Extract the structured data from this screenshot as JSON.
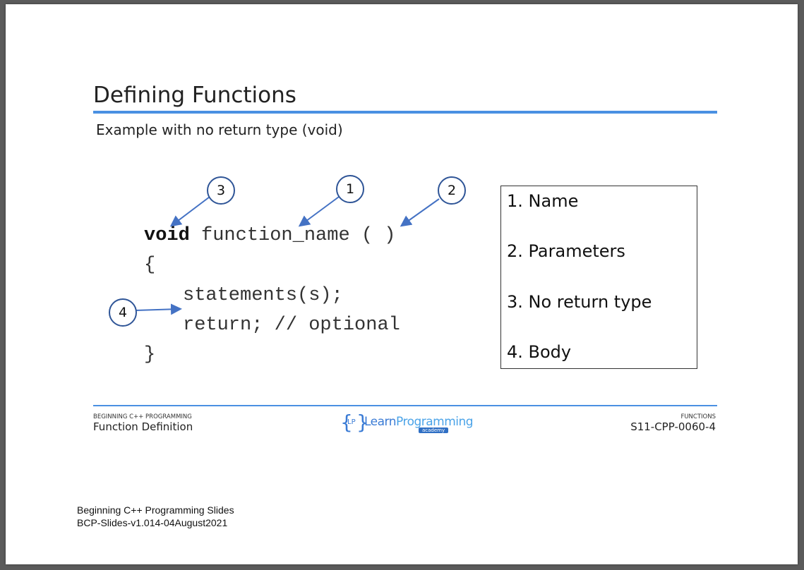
{
  "slide": {
    "title": "Defining Functions",
    "subtitle": "Example with no return type (void)",
    "code": {
      "keyword": "void",
      "signature_rest": " function_name ( )",
      "open_brace": "{",
      "line_statements": "statements(s);",
      "line_return": "return; // optional",
      "close_brace": "}"
    },
    "callouts": [
      "1",
      "2",
      "3",
      "4"
    ],
    "legend": [
      "1.  Name",
      "2.  Parameters",
      "3.  No return type",
      "4.  Body"
    ]
  },
  "footer": {
    "left_small": "BEGINNING C++ PROGRAMMING",
    "left_big": "Function Definition",
    "right_small": "FUNCTIONS",
    "right_big": "S11-CPP-0060-4",
    "logo": {
      "brace_left": "{",
      "mark": "LP",
      "brace_right": "}",
      "word_learn": "Learn",
      "word_programming": "Programming",
      "tag": "academy"
    }
  },
  "document_note": {
    "line1": "Beginning C++ Programming Slides",
    "line2": "BCP-Slides-v1.014-04August2021"
  },
  "colors": {
    "accent_blue": "#4a90e2",
    "callout_border": "#2f5597",
    "arrow_blue": "#4472c4"
  }
}
